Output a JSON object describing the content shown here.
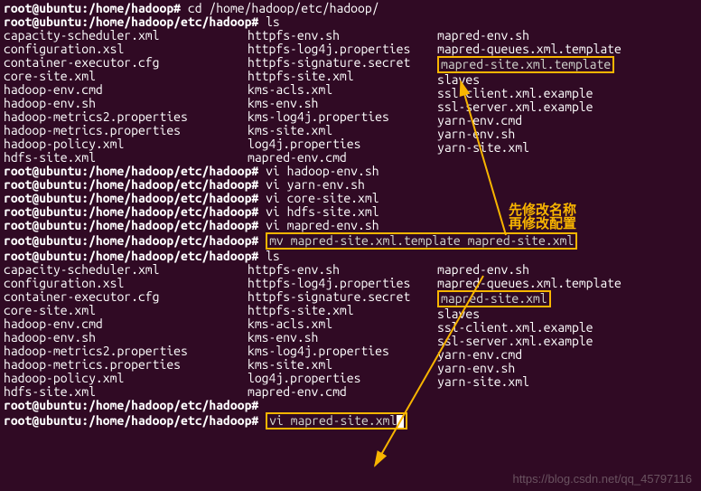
{
  "prompts": {
    "user": "root@ubuntu",
    "path_short": ":/home/hadoop#",
    "path_etc": ":/home/hadoop/etc/hadoop#"
  },
  "cmds": {
    "cd": "cd /home/hadoop/etc/hadoop/",
    "ls": "ls",
    "vi_hadoop_env": "vi hadoop-env.sh",
    "vi_yarn_env": "vi yarn-env.sh",
    "vi_core_site": "vi core-site.xml",
    "vi_hdfs_site": "vi hdfs-site.xml",
    "vi_mapred_env": "vi mapred-env.sh",
    "mv": "mv mapred-site.xml.template mapred-site.xml",
    "vi_mapred_site": "vi mapred-site.xml"
  },
  "ls1_col1": [
    "capacity-scheduler.xml",
    "configuration.xsl",
    "container-executor.cfg",
    "core-site.xml",
    "hadoop-env.cmd",
    "hadoop-env.sh",
    "hadoop-metrics2.properties",
    "hadoop-metrics.properties",
    "hadoop-policy.xml",
    "hdfs-site.xml"
  ],
  "ls1_col2": [
    "httpfs-env.sh",
    "httpfs-log4j.properties",
    "httpfs-signature.secret",
    "httpfs-site.xml",
    "kms-acls.xml",
    "kms-env.sh",
    "kms-log4j.properties",
    "kms-site.xml",
    "log4j.properties",
    "mapred-env.cmd"
  ],
  "ls1_col3": [
    "mapred-env.sh",
    "mapred-queues.xml.template",
    "mapred-site.xml.template",
    "slaves",
    "ssl-client.xml.example",
    "ssl-server.xml.example",
    "yarn-env.cmd",
    "yarn-env.sh",
    "yarn-site.xml",
    ""
  ],
  "ls2_col1": [
    "capacity-scheduler.xml",
    "configuration.xsl",
    "container-executor.cfg",
    "core-site.xml",
    "hadoop-env.cmd",
    "hadoop-env.sh",
    "hadoop-metrics2.properties",
    "hadoop-metrics.properties",
    "hadoop-policy.xml",
    "hdfs-site.xml"
  ],
  "ls2_col2": [
    "httpfs-env.sh",
    "httpfs-log4j.properties",
    "httpfs-signature.secret",
    "httpfs-site.xml",
    "kms-acls.xml",
    "kms-env.sh",
    "kms-log4j.properties",
    "kms-site.xml",
    "log4j.properties",
    "mapred-env.cmd"
  ],
  "ls2_col3": [
    "mapred-env.sh",
    "mapred-queues.xml.template",
    "mapred-site.xml",
    "slaves",
    "ssl-client.xml.example",
    "ssl-server.xml.example",
    "yarn-env.cmd",
    "yarn-env.sh",
    "yarn-site.xml",
    ""
  ],
  "annotation": {
    "line1": "先修改名称",
    "line2": "再修改配置"
  },
  "watermark": "https://blog.csdn.net/qq_45797116"
}
